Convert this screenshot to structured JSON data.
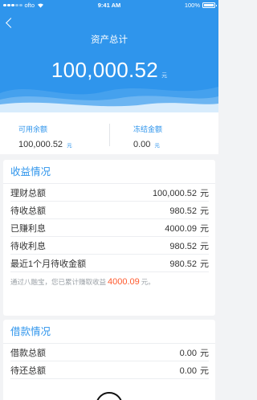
{
  "status_bar": {
    "carrier": "ofto",
    "time": "9:41 AM",
    "battery": "100%",
    "wifi_icon": "wifi-icon",
    "battery_icon": "battery-icon"
  },
  "nav": {
    "title": "资产总计",
    "back_icon": "chevron-left-icon"
  },
  "total": {
    "amount": "100,000.52",
    "unit": "元"
  },
  "balances": {
    "available": {
      "label": "可用余额",
      "value": "100,000.52",
      "unit": "元"
    },
    "frozen": {
      "label": "冻结金额",
      "value": "0.00",
      "unit": "元"
    }
  },
  "earnings": {
    "title": "收益情况",
    "rows": [
      {
        "label": "理财总额",
        "value": "100,000.52",
        "unit": "元"
      },
      {
        "label": "待收总额",
        "value": "980.52",
        "unit": "元"
      },
      {
        "label": "已赚利息",
        "value": "4000.09",
        "unit": "元"
      },
      {
        "label": "待收利息",
        "value": "980.52",
        "unit": "元"
      },
      {
        "label": "最近1个月待收金额",
        "value": "980.52",
        "unit": "元"
      }
    ],
    "note": {
      "prefix": "通过八融宝，您已累计赚取收益",
      "amount": "4000.09",
      "suffix": "元。"
    }
  },
  "loans": {
    "title": "借款情况",
    "rows": [
      {
        "label": "借款总额",
        "value": "0.00",
        "unit": "元"
      },
      {
        "label": "待还总额",
        "value": "0.00",
        "unit": "元"
      }
    ]
  },
  "colors": {
    "primary": "#2f95ec",
    "highlight": "#ff5a2e",
    "background": "#f2f3f5"
  }
}
